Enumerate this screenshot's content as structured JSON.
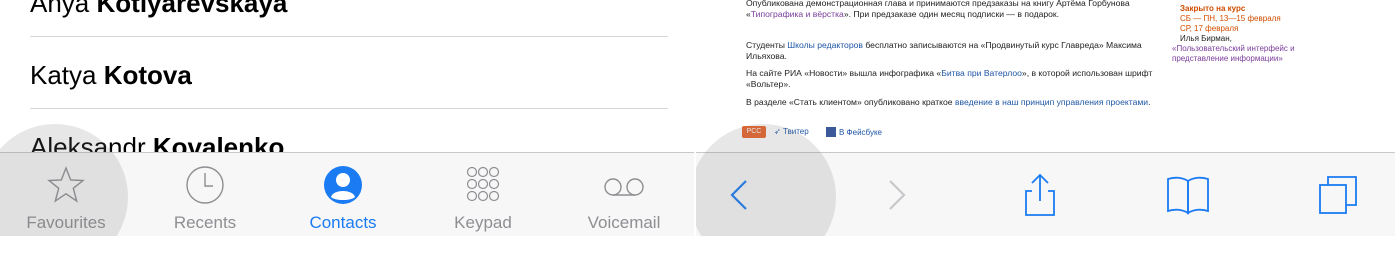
{
  "contacts": [
    {
      "first": "Anya",
      "last": "Kotlyarevskaya"
    },
    {
      "first": "Katya",
      "last": "Kotova"
    },
    {
      "first": "Aleksandr",
      "last": "Kovalenko"
    }
  ],
  "tabbar": {
    "tabs": [
      {
        "label": "Favourites",
        "icon": "star-icon",
        "active": false
      },
      {
        "label": "Recents",
        "icon": "clock-icon",
        "active": false
      },
      {
        "label": "Contacts",
        "icon": "person-icon",
        "active": true
      },
      {
        "label": "Keypad",
        "icon": "keypad-icon",
        "active": false
      },
      {
        "label": "Voicemail",
        "icon": "voicemail-icon",
        "active": false
      }
    ],
    "active_color": "#1a7bf2",
    "inactive_color": "#8e8e93"
  },
  "browser": {
    "paragraphs": [
      {
        "pre": "Опубликована демонстрационная глава и принимаются предзаказы на книгу Артёма Горбунова «",
        "link": "Типографика и вёрстка",
        "post": "». При предзаказе один месяц подписки — в подарок."
      },
      {
        "pre": "Студенты ",
        "link": "Школы редакторов",
        "post": " бесплатно записываются на «Продвинутый курс Главреда» Максима Ильяхова."
      },
      {
        "pre": "На сайте РИА «Новости» вышла инфографика «",
        "link": "Битва при Ватерлоо",
        "post": "», в которой использован шрифт «Вольтер»."
      },
      {
        "pre": "В разделе «Стать клиентом» опубликовано краткое ",
        "link": "введение в наш принцип управления проектами",
        "post": "."
      }
    ],
    "sidebar": {
      "closed_label": "Закрыто на курс",
      "dates1": "СБ — ПН, 13—15 февраля",
      "dates2": "СР, 17 февраля",
      "person": "Илья Бирман,",
      "course_link": "«Пользовательский интерфейс и представление информации»"
    },
    "share": {
      "rss": "РСС",
      "twitter": "Твитер",
      "facebook": "В Фейсбуке"
    },
    "toolbar": {
      "buttons": [
        "back-icon",
        "forward-icon",
        "share-icon",
        "bookmarks-icon",
        "tabs-icon"
      ]
    }
  }
}
